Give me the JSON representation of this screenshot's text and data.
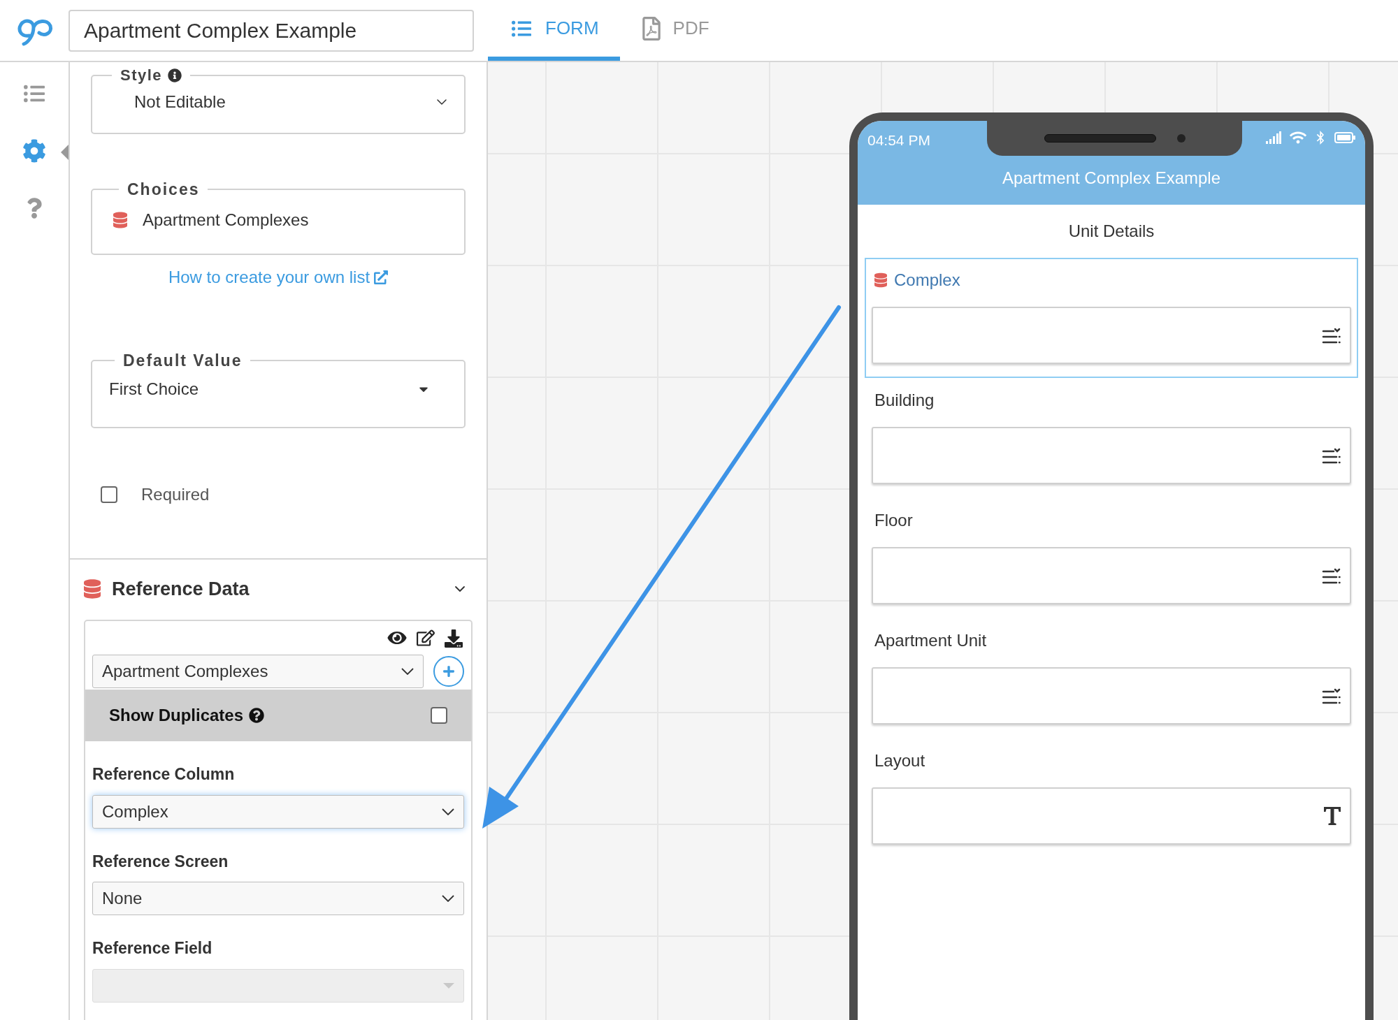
{
  "app": {
    "title": "Apartment Complex Example"
  },
  "tabs": [
    {
      "label": "FORM",
      "kind": "form",
      "selected": true
    },
    {
      "label": "PDF",
      "kind": "pdf",
      "selected": false
    }
  ],
  "rail": [
    {
      "kind": "list",
      "selected": false
    },
    {
      "kind": "settings",
      "selected": true
    },
    {
      "kind": "help",
      "selected": false
    }
  ],
  "properties": {
    "style": {
      "label": "Style",
      "value": "Not Editable"
    },
    "choices": {
      "label": "Choices",
      "value": "Apartment Complexes",
      "link": "How to create your own list"
    },
    "default_value": {
      "label": "Default Value",
      "value": "First Choice"
    },
    "required": {
      "label": "Required",
      "checked": false
    }
  },
  "reference_data": {
    "title": "Reference Data",
    "expanded": true,
    "list": "Apartment Complexes",
    "show_duplicates": {
      "label": "Show Duplicates",
      "checked": false
    },
    "fields": [
      {
        "label": "Reference Column",
        "value": "Complex",
        "focused": true,
        "disabled": false
      },
      {
        "label": "Reference Screen",
        "value": "None",
        "focused": false,
        "disabled": false
      },
      {
        "label": "Reference Field",
        "focused": false,
        "disabled": true
      }
    ]
  },
  "phone": {
    "time": "04:54 PM",
    "title": "Apartment Complex Example",
    "screen": "Unit Details",
    "fields": [
      {
        "label": "Complex",
        "kind": "list",
        "selected": true,
        "reference": true
      },
      {
        "label": "Building",
        "kind": "list",
        "selected": false,
        "reference": false
      },
      {
        "label": "Floor",
        "kind": "list",
        "selected": false,
        "reference": false
      },
      {
        "label": "Apartment Unit",
        "kind": "list",
        "selected": false,
        "reference": false
      },
      {
        "label": "Layout",
        "kind": "text",
        "selected": false,
        "reference": false
      }
    ]
  }
}
